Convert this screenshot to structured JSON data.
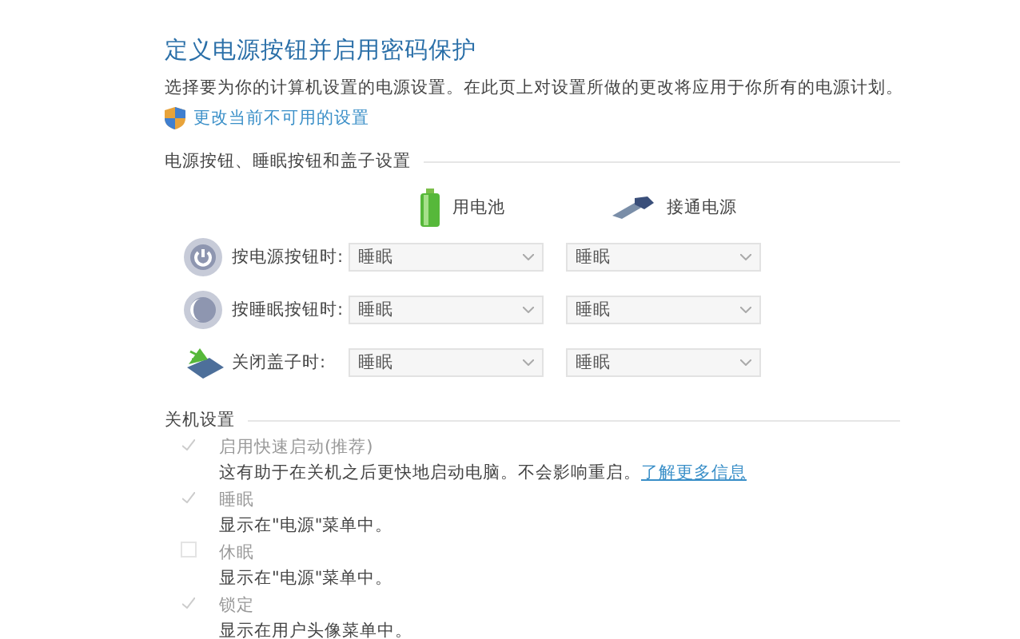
{
  "title": "定义电源按钮并启用密码保护",
  "description": "选择要为你的计算机设置的电源设置。在此页上对设置所做的更改将应用于你所有的电源计划。",
  "admin_link": "更改当前不可用的设置",
  "buttons_section": {
    "heading": "电源按钮、睡眠按钮和盖子设置",
    "columns": [
      {
        "kind": "battery",
        "label": "用电池"
      },
      {
        "kind": "plugged",
        "label": "接通电源"
      }
    ],
    "rows": [
      {
        "kind": "power",
        "label": "按电源按钮时:",
        "values": [
          "睡眠",
          "睡眠"
        ]
      },
      {
        "kind": "sleep",
        "label": "按睡眠按钮时:",
        "values": [
          "睡眠",
          "睡眠"
        ]
      },
      {
        "kind": "lid",
        "label": "关闭盖子时:",
        "values": [
          "睡眠",
          "睡眠"
        ]
      }
    ]
  },
  "shutdown_section": {
    "heading": "关机设置",
    "options": [
      {
        "label": "启用快速启动(推荐)",
        "description": "这有助于在关机之后更快地启动电脑。不会影响重启。",
        "link": "了解更多信息",
        "checked": true,
        "disabled": true
      },
      {
        "label": "睡眠",
        "description": "显示在\"电源\"菜单中。",
        "checked": true,
        "disabled": true
      },
      {
        "label": "休眠",
        "description": "显示在\"电源\"菜单中。",
        "checked": false,
        "disabled": true
      },
      {
        "label": "锁定",
        "description": "显示在用户头像菜单中。",
        "checked": true,
        "disabled": true
      }
    ]
  }
}
